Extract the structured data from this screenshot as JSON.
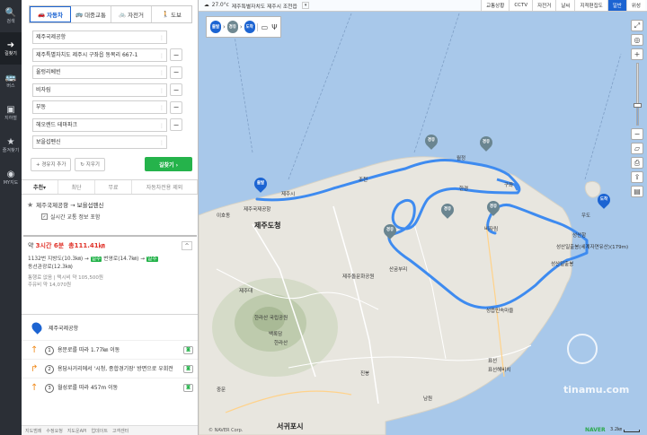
{
  "rail": {
    "items": [
      {
        "icon": "🔍",
        "label": "검색"
      },
      {
        "icon": "➜",
        "label": "길찾기"
      },
      {
        "icon": "🚌",
        "label": "버스"
      },
      {
        "icon": "▣",
        "label": "지하철"
      },
      {
        "icon": "★",
        "label": "즐겨찾기"
      },
      {
        "icon": "◉",
        "label": "MY지도"
      }
    ]
  },
  "modes": [
    {
      "icon": "🚗",
      "label": "자동차"
    },
    {
      "icon": "🚌",
      "label": "대중교통"
    },
    {
      "icon": "🚲",
      "label": "자전거"
    },
    {
      "icon": "🚶",
      "label": "도보"
    }
  ],
  "waypoints": [
    "제주국제공항",
    "제주특별자치도 제주시 구좌읍 동복리 667-1",
    "울렁리베빈",
    "비자림",
    "부동",
    "헤오렌드 테마파크",
    "보을섭펜신"
  ],
  "actions": {
    "add": "+ 경유지 추가",
    "reset": "↻ 지우기",
    "go": "길찾기 ›"
  },
  "sort_tabs": [
    "추천▾",
    "최단",
    "무료",
    "자동차전용 제외"
  ],
  "route": {
    "name": "제주국제공항 → 보을섭펜신",
    "realtime": "실시간 교통 정보 포함",
    "time_prefix": "약 ",
    "time": "3시간 6분",
    "distance": "총111.41㎞",
    "line1a": "1132번 지방도(10.3㎞) → ",
    "line1b": "일주",
    "line1c": " 번영로(14.7㎞) → ",
    "line1d": "일주",
    "line2": "동선관광로(12.3㎞)",
    "toll": "통행료 없음 | 택시비 약 105,500원",
    "fuel": "주유비 약 14,070원"
  },
  "steps": {
    "start": "제주국제공항",
    "items": [
      {
        "num": "1",
        "text": "용문로를 따라 1.77㎞ 이동",
        "arrow": "↑"
      },
      {
        "num": "2",
        "text": "용담사거리에서 '시청, 종합경기장' 방면으로 우회전",
        "arrow": "↱"
      },
      {
        "num": "3",
        "text": "월성로를 따라 457m 이동",
        "arrow": "↑"
      }
    ]
  },
  "footer": [
    "지도범례",
    "수정요청",
    "지도운API",
    "업데이트",
    "고객센터"
  ],
  "topbar": {
    "weather": "27.0°c",
    "address": "제주특별자치도 제주시 조천읍",
    "layers": [
      "교통상황",
      "CCTV",
      "자전거",
      "날씨",
      "지적편집도",
      "일반",
      "위성"
    ]
  },
  "route_chips": [
    {
      "label": "출발",
      "kind": "blue"
    },
    {
      "label": "경유",
      "kind": "gray"
    },
    {
      "label": "도착",
      "kind": "blue"
    }
  ],
  "map": {
    "labels": {
      "jeju_city": "제주도청",
      "jeju_si": "제주시",
      "airport": "이호동",
      "jocheon": "조천",
      "woljeong": "월정",
      "handong": "한경",
      "hancheon": "한라산",
      "seongsan": "성산일출봉",
      "bijarim": "비자림",
      "hallasan_park": "한라산 국립공원",
      "gujwa": "구좌",
      "pyoseon": "표선",
      "namwon": "남원",
      "seogwipo": "서귀포시",
      "jungmun": "중문",
      "seongsan_port": "성산항",
      "airport_name": "제주국제공항",
      "udo": "우도",
      "pyoseon_beach": "표선해비치",
      "baekrok": "백록담",
      "sanbang": "산굼부리",
      "jinbong": "진봉",
      "jeju_national": "제주대",
      "hotspring": "제주돌문화공원",
      "seongeup": "성읍민속마을",
      "seongsan_ilchul": "성산일출봉(세계자연유산)(179m)"
    },
    "copyright": "© NAVER Corp.",
    "naver": "NAVER",
    "scale": "3.2㎞",
    "watermark": "tinamu.com"
  },
  "zoom": {
    "level_fraction": 0.3
  },
  "colors": {
    "accent": "#1c64d2",
    "go": "#25b34b",
    "route_line": "#3e8bf0",
    "land": "#e8e6df",
    "water": "#a8c8ea"
  }
}
